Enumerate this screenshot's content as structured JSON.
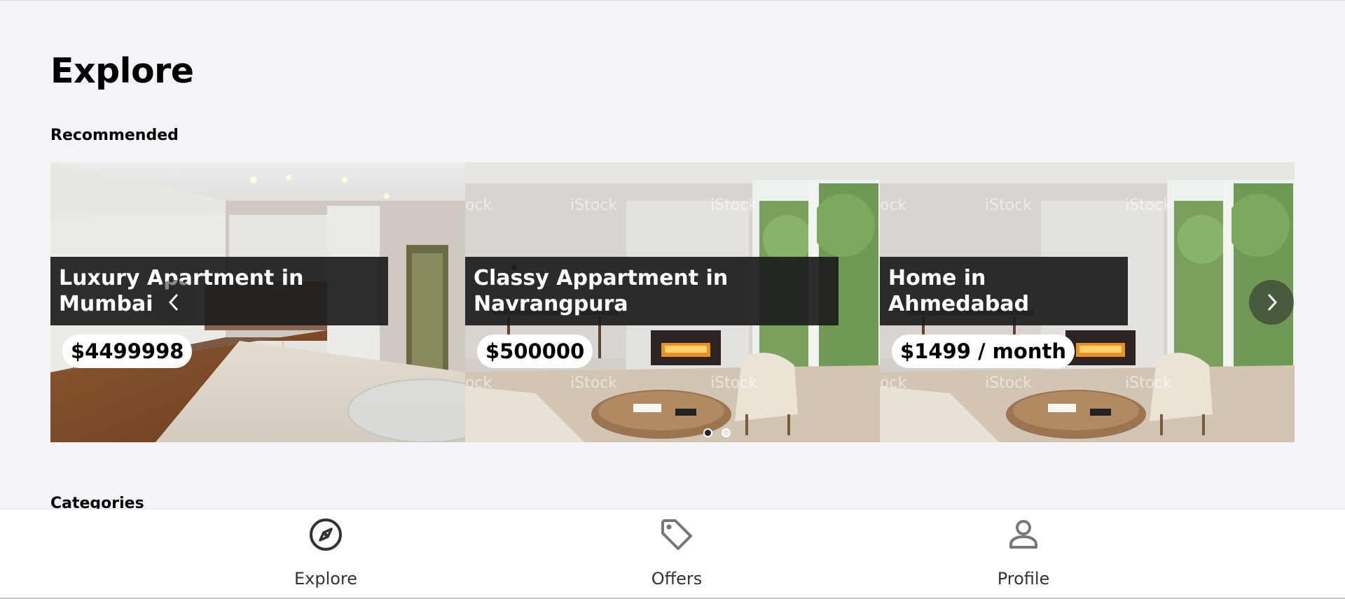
{
  "page": {
    "title": "Explore"
  },
  "sections": {
    "recommended": "Recommended",
    "categories": "Categories"
  },
  "listings": [
    {
      "title": "Luxury Apartment in Mumbai",
      "price": "$4499998",
      "image": "kitchen-photo"
    },
    {
      "title": "Classy Appartment in Navrangpura",
      "price": "$500000",
      "image": "living-room-photo"
    },
    {
      "title": "Home in Ahmedabad",
      "price": "$1499 / month",
      "image": "living-room-photo"
    }
  ],
  "carousel": {
    "total_pages": 2,
    "active_page": 1
  },
  "bottom_nav": [
    {
      "label": "Explore",
      "icon": "compass-icon"
    },
    {
      "label": "Offers",
      "icon": "tag-icon"
    },
    {
      "label": "Profile",
      "icon": "person-icon"
    }
  ],
  "colors": {
    "background": "#f2f4f8",
    "caption_bg": "#1c1c1c",
    "nav_bg": "#ffffff",
    "icon": "#333333"
  }
}
